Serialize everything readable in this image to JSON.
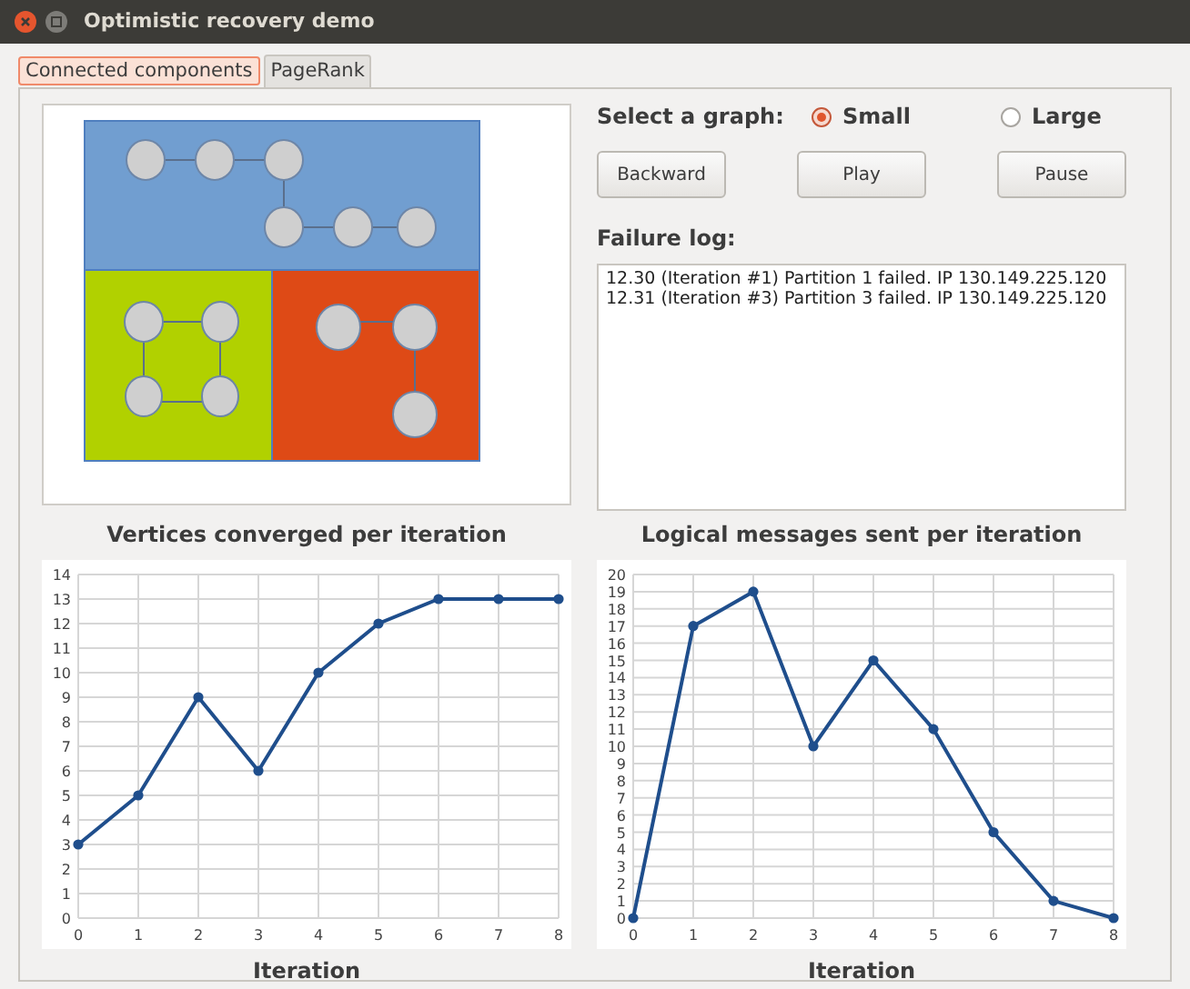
{
  "window": {
    "title": "Optimistic recovery demo"
  },
  "tabs": [
    {
      "label": "Connected components",
      "selected": true
    },
    {
      "label": "PageRank",
      "selected": false
    }
  ],
  "graph_select": {
    "label": "Select a graph:",
    "options": [
      {
        "label": "Small",
        "selected": true
      },
      {
        "label": "Large",
        "selected": false
      }
    ]
  },
  "buttons": [
    "Backward",
    "Play",
    "Pause"
  ],
  "failure_log": {
    "label": "Failure log:",
    "lines": [
      "12.30 (Iteration #1) Partition 1 failed. IP 130.149.225.120",
      "12.31 (Iteration #3) Partition 3 failed. IP 130.149.225.120"
    ]
  },
  "charts": [
    {
      "chart_data": {
        "type": "line",
        "title": "Vertices converged per iteration",
        "xlabel": "Iteration",
        "x": [
          0,
          1,
          2,
          3,
          4,
          5,
          6,
          7,
          8
        ],
        "xlim": [
          0,
          8
        ],
        "xticks": [
          0,
          1,
          2,
          3,
          4,
          5,
          6,
          7,
          8
        ],
        "ylim": [
          0,
          14
        ],
        "grid": true,
        "yticks": [
          0,
          1,
          2,
          3,
          4,
          5,
          6,
          7,
          8,
          9,
          10,
          11,
          12,
          13,
          14
        ],
        "series": [
          {
            "color": "#1f4e8c",
            "marker": "circle",
            "values": [
              3,
              5,
              9,
              6,
              10,
              12,
              13,
              13,
              13
            ]
          }
        ]
      }
    },
    {
      "chart_data": {
        "type": "line",
        "title": "Logical messages sent per iteration",
        "xlabel": "Iteration",
        "x": [
          0,
          1,
          2,
          3,
          4,
          5,
          6,
          7,
          8
        ],
        "xlim": [
          0,
          8
        ],
        "xticks": [
          0,
          1,
          2,
          3,
          4,
          5,
          6,
          7,
          8
        ],
        "ylim": [
          0,
          20
        ],
        "grid": true,
        "yticks": [
          0,
          1,
          2,
          3,
          4,
          5,
          6,
          7,
          8,
          9,
          10,
          11,
          12,
          13,
          14,
          15,
          16,
          17,
          18,
          19,
          20
        ],
        "series": [
          {
            "color": "#1f4e8c",
            "marker": "circle",
            "values": [
              0,
              17,
              19,
              10,
              15,
              11,
              5,
              1,
              0
            ]
          }
        ]
      }
    }
  ]
}
